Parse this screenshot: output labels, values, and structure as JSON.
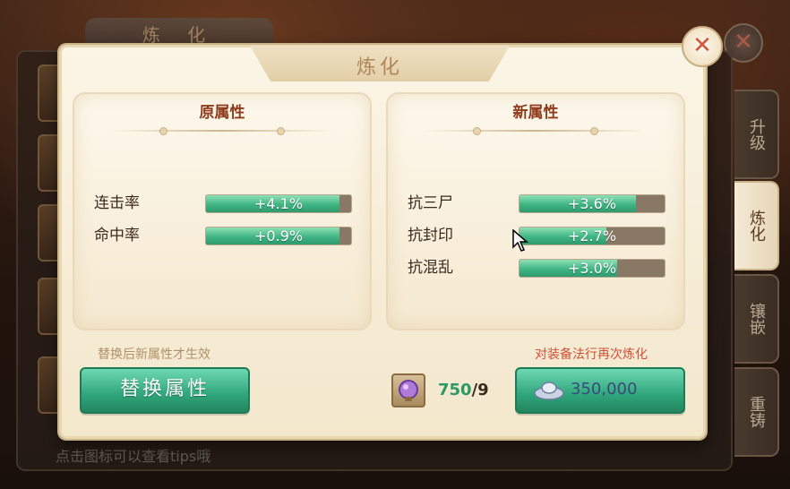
{
  "background": {
    "tab_title": "炼 化",
    "tip_text": "点击图标可以查看tips哦",
    "side_tabs": [
      {
        "label": "升级",
        "active": false
      },
      {
        "label": "炼化",
        "active": true
      },
      {
        "label": "镶嵌",
        "active": false
      },
      {
        "label": "重铸",
        "active": false
      }
    ]
  },
  "dialog": {
    "title": "炼化",
    "close_icon": "close-x-icon",
    "original": {
      "title": "原属性",
      "attrs": [
        {
          "name": "连击率",
          "value": "+4.1%",
          "fill": 0.92
        },
        {
          "name": "命中率",
          "value": "+0.9%",
          "fill": 0.92
        }
      ]
    },
    "new": {
      "title": "新属性",
      "attrs": [
        {
          "name": "抗三尸",
          "value": "+3.6%",
          "fill": 0.8
        },
        {
          "name": "抗封印",
          "value": "+2.7%",
          "fill": 0.6
        },
        {
          "name": "抗混乱",
          "value": "+3.0%",
          "fill": 0.67
        }
      ]
    },
    "hint_left": "替换后新属性才生效",
    "hint_right": "对装备法行再次炼化",
    "replace_button": "替换属性",
    "gem_icon": "purple-gem-icon",
    "gem_have": "750",
    "gem_need": "/9",
    "refine_icon": "silver-ingot-icon",
    "refine_cost": "350,000"
  },
  "colors": {
    "accent_green": "#3fb583",
    "title_red": "#8e3a1c",
    "hint_red": "#d0503a"
  }
}
